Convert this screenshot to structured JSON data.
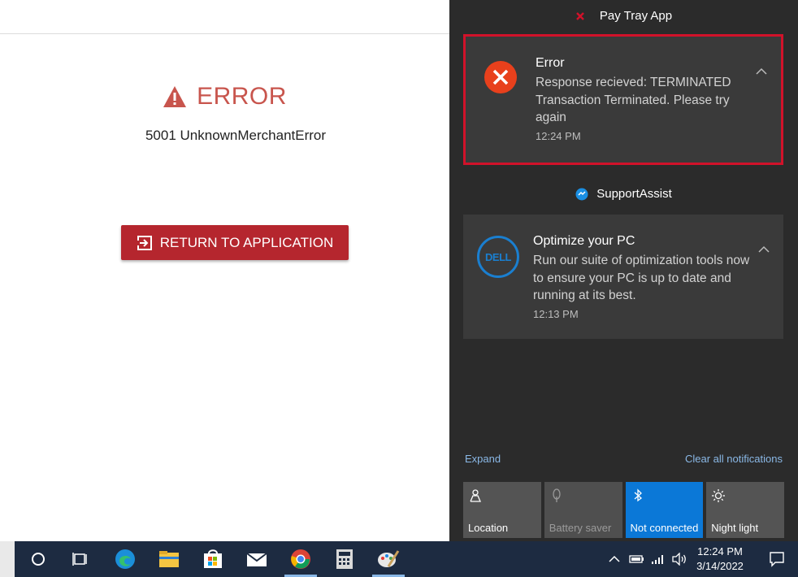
{
  "page": {
    "error_title": "ERROR",
    "error_message": "5001 UnknownMerchantError",
    "return_button_label": "RETURN TO APPLICATION"
  },
  "action_center": {
    "groups": [
      {
        "app_name": "Pay Tray App",
        "notification": {
          "title": "Error",
          "body": "Response recieved: TERMINATED Transaction Terminated. Please try again",
          "time": "12:24 PM"
        }
      },
      {
        "app_name": "SupportAssist",
        "notification": {
          "title": "Optimize your PC",
          "body": "Run our suite of optimization tools now to ensure your PC is up to date and running at its best.",
          "time": "12:13 PM",
          "icon_text": "DELL"
        }
      }
    ],
    "expand_label": "Expand",
    "clear_all_label": "Clear all notifications",
    "quick_actions": [
      {
        "label": "Location",
        "icon": "location-icon",
        "state": "normal"
      },
      {
        "label": "Battery saver",
        "icon": "battery-saver-icon",
        "state": "disabled"
      },
      {
        "label": "Not connected",
        "icon": "bluetooth-icon",
        "state": "active"
      },
      {
        "label": "Night light",
        "icon": "night-light-icon",
        "state": "normal"
      }
    ]
  },
  "taskbar": {
    "clock_time": "12:24 PM",
    "clock_date": "3/14/2022",
    "apps": [
      "cortana-icon",
      "task-view-icon",
      "edge-icon",
      "file-explorer-icon",
      "store-icon",
      "mail-icon",
      "chrome-icon",
      "calculator-icon",
      "paint-icon"
    ]
  },
  "colors": {
    "error_red": "#b5262e",
    "error_text": "#c8554d",
    "highlight_border": "#d1122a",
    "active_tile": "#0b78d7",
    "taskbar": "#1d2b41"
  }
}
